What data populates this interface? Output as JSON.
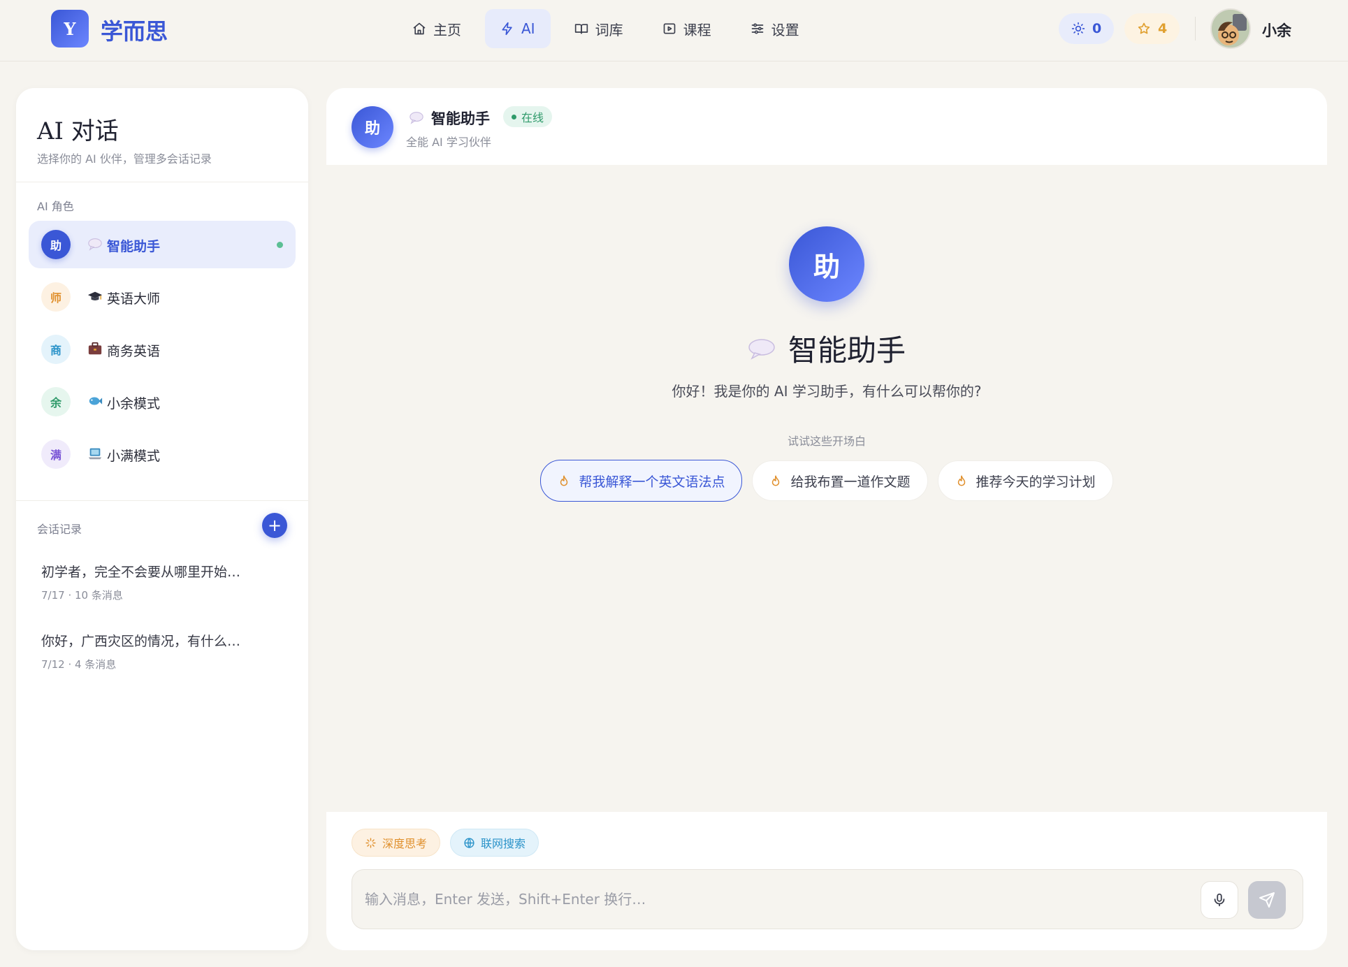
{
  "header": {
    "logo_letter": "Y",
    "brand": "学而思",
    "nav": [
      {
        "label": "主页",
        "icon": "home-icon"
      },
      {
        "label": "AI",
        "icon": "lightning-icon",
        "active": true
      },
      {
        "label": "词库",
        "icon": "book-icon"
      },
      {
        "label": "课程",
        "icon": "play-icon"
      },
      {
        "label": "设置",
        "icon": "sliders-icon"
      }
    ],
    "sun_count": "0",
    "star_count": "4",
    "user_name": "小余"
  },
  "sidebar": {
    "title": "AI 对话",
    "subtitle": "选择你的 AI 伙伴，管理多会话记录",
    "roles_label": "AI 角色",
    "roles": [
      {
        "badge": "助",
        "name": "智能助手",
        "emoji": "speech-bubble-icon",
        "active": true,
        "badge_bg": "#3a57d6",
        "badge_fg": "#ffffff"
      },
      {
        "badge": "师",
        "name": "英语大师",
        "emoji": "graduation-cap-icon",
        "badge_bg": "#fdf1e2",
        "badge_fg": "#e0902d"
      },
      {
        "badge": "商",
        "name": "商务英语",
        "emoji": "briefcase-icon",
        "badge_bg": "#e4f3fb",
        "badge_fg": "#2b93c9"
      },
      {
        "badge": "余",
        "name": "小余模式",
        "emoji": "fish-icon",
        "badge_bg": "#e6f6ee",
        "badge_fg": "#2f9a6a"
      },
      {
        "badge": "满",
        "name": "小满模式",
        "emoji": "laptop-icon",
        "badge_bg": "#f0ebfb",
        "badge_fg": "#7a55d6"
      }
    ],
    "history_label": "会话记录",
    "add_label": "+",
    "conversations": [
      {
        "title": "初学者，完全不会要从哪里开始…",
        "meta": "7/17 · 10 条消息"
      },
      {
        "title": "你好，广西灾区的情况，有什么…",
        "meta": "7/12 · 4 条消息"
      }
    ]
  },
  "chat": {
    "avatar_letter": "助",
    "name": "智能助手",
    "status": "在线",
    "tagline": "全能 AI 学习伙伴",
    "welcome_title": "智能助手",
    "welcome_text": "你好！我是你的 AI 学习助手，有什么可以帮你的?",
    "starters_label": "试试这些开场白",
    "starters": [
      "帮我解释一个英文语法点",
      "给我布置一道作文题",
      "推荐今天的学习计划"
    ],
    "mode_deep": "深度思考",
    "mode_search": "联网搜索",
    "input_placeholder": "输入消息，Enter 发送，Shift+Enter 换行…"
  },
  "colors": {
    "accent": "#3a57d6",
    "background": "#f6f4ef",
    "online": "#2f9a6a",
    "gold": "#e0a030",
    "deep_think": "#e0902d",
    "web_search": "#2b93c9"
  }
}
